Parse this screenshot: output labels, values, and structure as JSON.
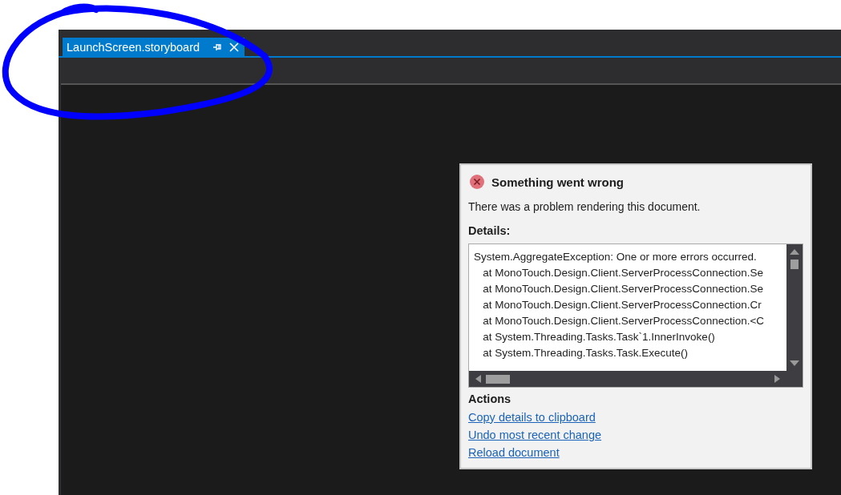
{
  "tabs": [
    {
      "label": "LaunchScreen.storyboard",
      "selected": true
    }
  ],
  "dialog": {
    "title": "Something went wrong",
    "message": "There was a problem rendering this document.",
    "details_label": "Details:",
    "details_lines": [
      "System.AggregateException: One or more errors occurred.",
      "   at MonoTouch.Design.Client.ServerProcessConnection.Se",
      "   at MonoTouch.Design.Client.ServerProcessConnection.Se",
      "   at MonoTouch.Design.Client.ServerProcessConnection.Cr",
      "   at MonoTouch.Design.Client.ServerProcessConnection.<C",
      "   at System.Threading.Tasks.Task`1.InnerInvoke()",
      "   at System.Threading.Tasks.Task.Execute()"
    ],
    "actions_label": "Actions",
    "actions": [
      "Copy details to clipboard",
      "Undo most recent change",
      "Reload document"
    ]
  }
}
